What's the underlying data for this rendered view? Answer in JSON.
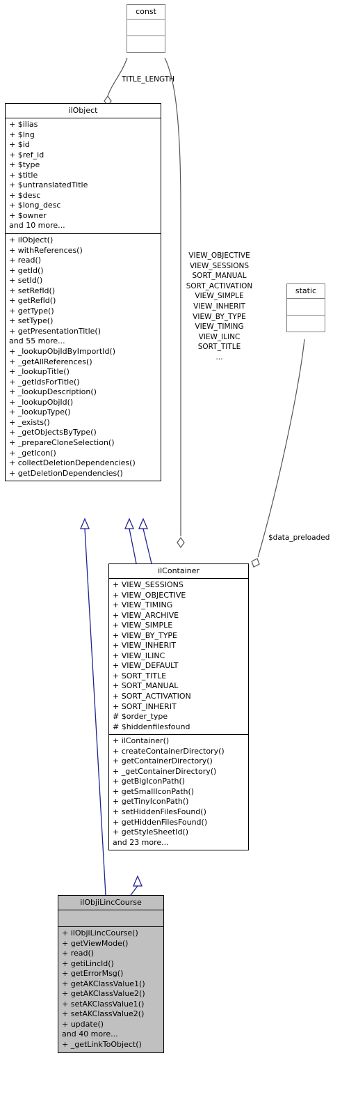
{
  "diagram": {
    "kind": "uml-class-diagram",
    "colors": {
      "inheritance_edge": "#22228f",
      "aggregation_edge": "#555555",
      "class_border": "#000000",
      "helper_border": "#7f7f7f",
      "highlight_fill": "#c0c0c0",
      "background": "#ffffff"
    }
  },
  "classes": {
    "const": {
      "name": "const",
      "attributes": [],
      "operations": []
    },
    "static": {
      "name": "static",
      "attributes": [],
      "operations": []
    },
    "ilObject": {
      "name": "ilObject",
      "attributes": [
        "+ $ilias",
        "+ $lng",
        "+ $id",
        "+ $ref_id",
        "+ $type",
        "+ $title",
        "+ $untranslatedTitle",
        "+ $desc",
        "+ $long_desc",
        "+ $owner",
        "and 10 more..."
      ],
      "operations": [
        "+ ilObject()",
        "+ withReferences()",
        "+ read()",
        "+ getId()",
        "+ setId()",
        "+ setRefId()",
        "+ getRefId()",
        "+ getType()",
        "+ setType()",
        "+ getPresentationTitle()",
        "and 55 more...",
        "+ _lookupObjIdByImportId()",
        "+ _getAllReferences()",
        "+ _lookupTitle()",
        "+ _getIdsForTitle()",
        "+ _lookupDescription()",
        "+ _lookupObjId()",
        "+ _lookupType()",
        "+ _exists()",
        "+ _getObjectsByType()",
        "+ _prepareCloneSelection()",
        "+ _getIcon()",
        "+ collectDeletionDependencies()",
        "+ getDeletionDependencies()"
      ]
    },
    "ilContainer": {
      "name": "ilContainer",
      "attributes": [
        "+ VIEW_SESSIONS",
        "+ VIEW_OBJECTIVE",
        "+ VIEW_TIMING",
        "+ VIEW_ARCHIVE",
        "+ VIEW_SIMPLE",
        "+ VIEW_BY_TYPE",
        "+ VIEW_INHERIT",
        "+ VIEW_ILINC",
        "+ VIEW_DEFAULT",
        "+ SORT_TITLE",
        "+ SORT_MANUAL",
        "+ SORT_ACTIVATION",
        "+ SORT_INHERIT",
        "# $order_type",
        "# $hiddenfilesfound"
      ],
      "operations": [
        "+ ilContainer()",
        "+ createContainerDirectory()",
        "+ getContainerDirectory()",
        "+ _getContainerDirectory()",
        "+ getBigIconPath()",
        "+ getSmallIconPath()",
        "+ getTinyIconPath()",
        "+ setHiddenFilesFound()",
        "+ getHiddenFilesFound()",
        "+ getStyleSheetId()",
        "and 23 more..."
      ]
    },
    "ilObjiLincCourse": {
      "name": "ilObjiLincCourse",
      "attributes": [],
      "operations": [
        "+ ilObjiLincCourse()",
        "+ getViewMode()",
        "+ read()",
        "+ getiLincId()",
        "+ getErrorMsg()",
        "+ getAKClassValue1()",
        "+ getAKClassValue2()",
        "+ setAKClassValue1()",
        "+ setAKClassValue2()",
        "+ update()",
        "and 40 more...",
        "+ _getLinkToObject()"
      ]
    }
  },
  "edge_labels": {
    "title_length": "TITLE_LENGTH",
    "const_to_container": [
      "VIEW_OBJECTIVE",
      "VIEW_SESSIONS",
      "SORT_MANUAL",
      "SORT_ACTIVATION",
      "VIEW_SIMPLE",
      "VIEW_INHERIT",
      "VIEW_BY_TYPE",
      "VIEW_TIMING",
      "VIEW_ILINC",
      "SORT_TITLE",
      "..."
    ],
    "data_preloaded": "$data_preloaded"
  }
}
